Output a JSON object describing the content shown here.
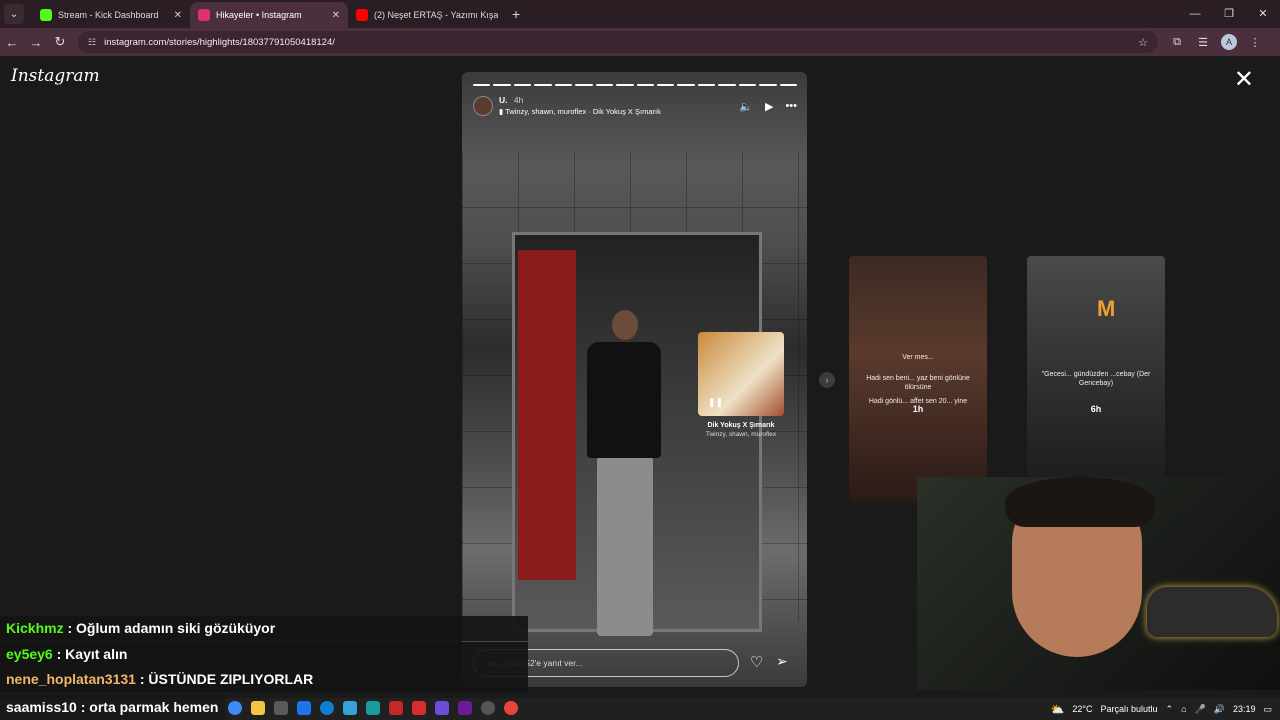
{
  "browser": {
    "tabs": [
      {
        "label": "Stream - Kick Dashboard",
        "active": false,
        "favicon_color": "#53fc18"
      },
      {
        "label": "Hikayeler • Instagram",
        "active": true,
        "favicon_color": "#e1306c"
      },
      {
        "label": "(2) Neşet ERTAŞ - Yazımı Kışa Ç",
        "active": false,
        "favicon_color": "#ff0000"
      }
    ],
    "url": "instagram.com/stories/highlights/18037791050418124/",
    "profile_initial": "A"
  },
  "instagram": {
    "logo": "Instagram",
    "story": {
      "username": "U.",
      "age": "4h",
      "song": "Twinzy, shawn, muroflex · Dik Yokuş X Şımarık",
      "sticker_title": "Dik Yokuş X Şımarık",
      "sticker_artist": "Twinzy, shawn, muroflex",
      "reply_placeholder": "wq_umut052'e yanıt ver...",
      "segments_total": 16,
      "segments_done": 16
    },
    "previews": [
      {
        "text_top": "Ver mes...",
        "text": "Hadi sen beni... yaz beni gönlüne ölürsüne",
        "text_bottom": "Hadi gönlü... affet sen 20... yine",
        "age": "1h"
      },
      {
        "text": "\"Gecesi... gündüzden ...cebay (Der Gencebay)",
        "age": "6h"
      }
    ]
  },
  "chat": [
    {
      "user": "Kickhmz",
      "message": "Oğlum adamın siki gözüküyor",
      "color": "#53fc18"
    },
    {
      "user": "ey5ey6",
      "message": "Kayıt alın",
      "color": "#53fc18"
    },
    {
      "user": "nene_hoplatan3131",
      "message": "ÜSTÜNDE ZIPLIYORLAR",
      "color": "#f2b66b"
    },
    {
      "user": "saamiss10",
      "message": "orta parmak hemen",
      "color": "#ffffff"
    }
  ],
  "taskbar": {
    "temperature": "22°C",
    "weather": "Parçalı bulutlu",
    "time": "23:19",
    "app_colors": [
      "#3d8af7",
      "#f4c542",
      "#5a5a5a",
      "#1b74e8",
      "#0e7fd1",
      "#34a3d8",
      "#1a9b9c",
      "#c62828",
      "#d32f2f",
      "#6d4dd6",
      "#6a1b9a",
      "#555555",
      "#e8453c"
    ]
  }
}
